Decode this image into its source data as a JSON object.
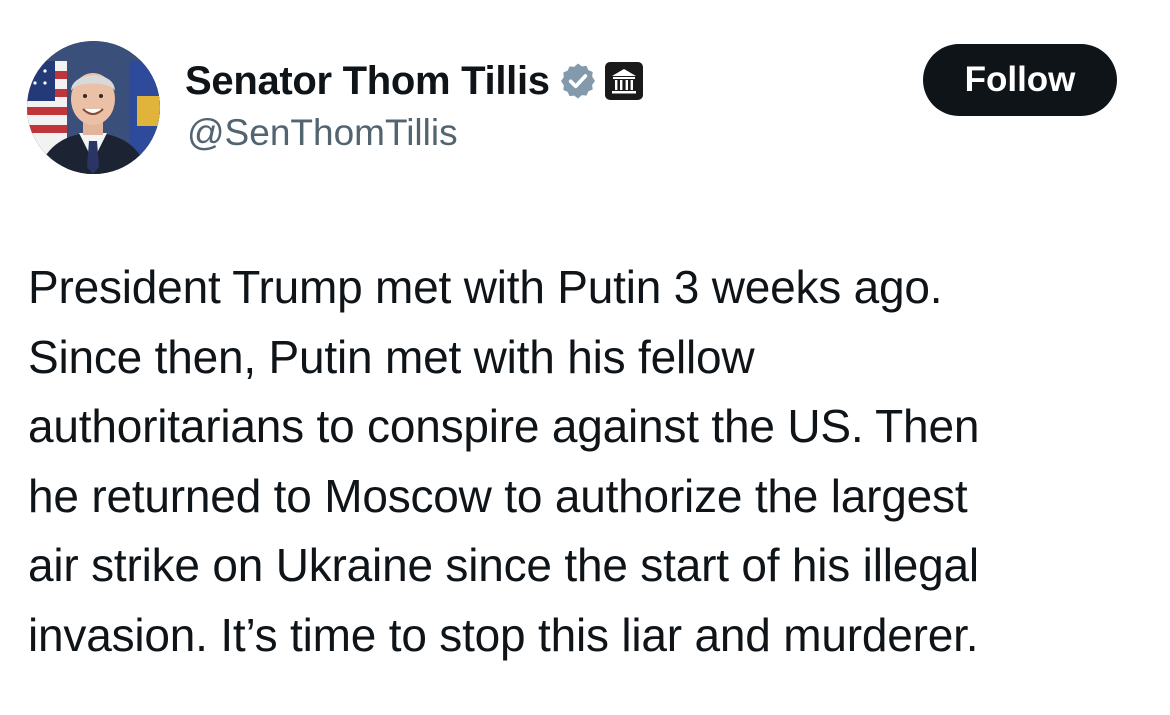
{
  "author": {
    "display_name": "Senator Thom Tillis",
    "handle": "@SenThomTillis",
    "verified_badge_icon": "verified-check-icon",
    "verified_badge_color": "#829aab",
    "affiliation_icon": "government-building-icon"
  },
  "follow_button": {
    "label": "Follow"
  },
  "tweet": {
    "lines": [
      "President Trump met with Putin 3 weeks ago.",
      "Since then, Putin met with his fellow",
      "authoritarians to conspire against the US. Then",
      "he returned to Moscow to authorize the largest",
      "air strike on Ukraine since the start of his illegal",
      "invasion. It’s time to stop this liar and murderer."
    ]
  },
  "colors": {
    "text_primary": "#0f1419",
    "text_secondary": "#536471",
    "button_bg": "#0f1419",
    "button_text": "#ffffff"
  }
}
